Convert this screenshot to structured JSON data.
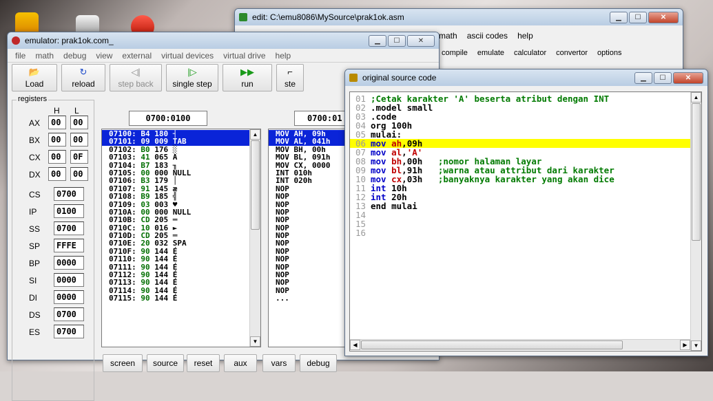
{
  "edit_window": {
    "title": "edit: C:\\emu8086\\MySource\\prak1ok.asm",
    "menu": [
      "math",
      "ascii codes",
      "help"
    ],
    "tools": [
      "compile",
      "emulate",
      "calculator",
      "convertor",
      "options"
    ]
  },
  "emulator": {
    "title": "emulator: prak1ok.com_",
    "menu": [
      "file",
      "math",
      "debug",
      "view",
      "external",
      "virtual devices",
      "virtual drive",
      "help"
    ],
    "toolbar": {
      "load": "Load",
      "reload": "reload",
      "step_back": "step back",
      "single_step": "single step",
      "run": "run",
      "step_delay": "ste"
    },
    "registers": {
      "legend": "registers",
      "h": "H",
      "l": "L",
      "ax": {
        "name": "AX",
        "h": "00",
        "l": "00"
      },
      "bx": {
        "name": "BX",
        "h": "00",
        "l": "00"
      },
      "cx": {
        "name": "CX",
        "h": "00",
        "l": "0F"
      },
      "dx": {
        "name": "DX",
        "h": "00",
        "l": "00"
      },
      "cs": {
        "name": "CS",
        "v": "0700"
      },
      "ip": {
        "name": "IP",
        "v": "0100"
      },
      "ss": {
        "name": "SS",
        "v": "0700"
      },
      "sp": {
        "name": "SP",
        "v": "FFFE"
      },
      "bp": {
        "name": "BP",
        "v": "0000"
      },
      "si": {
        "name": "SI",
        "v": "0000"
      },
      "di": {
        "name": "DI",
        "v": "0000"
      },
      "ds": {
        "name": "DS",
        "v": "0700"
      },
      "es": {
        "name": "ES",
        "v": "0700"
      }
    },
    "mem_address": "0700:0100",
    "dis_address": "0700:01",
    "memory": [
      {
        "a": "07100:",
        "h": "B4",
        "d": "180",
        "c": "┤"
      },
      {
        "a": "07101:",
        "h": "09",
        "d": "009",
        "c": "TAB"
      },
      {
        "a": "07102:",
        "h": "B0",
        "d": "176",
        "c": "░"
      },
      {
        "a": "07103:",
        "h": "41",
        "d": "065",
        "c": "A"
      },
      {
        "a": "07104:",
        "h": "B7",
        "d": "183",
        "c": "╖"
      },
      {
        "a": "07105:",
        "h": "00",
        "d": "000",
        "c": "NULL"
      },
      {
        "a": "07106:",
        "h": "B3",
        "d": "179",
        "c": "│"
      },
      {
        "a": "07107:",
        "h": "91",
        "d": "145",
        "c": "æ"
      },
      {
        "a": "07108:",
        "h": "B9",
        "d": "185",
        "c": "╣"
      },
      {
        "a": "07109:",
        "h": "03",
        "d": "003",
        "c": "♥"
      },
      {
        "a": "0710A:",
        "h": "00",
        "d": "000",
        "c": "NULL"
      },
      {
        "a": "0710B:",
        "h": "CD",
        "d": "205",
        "c": "═"
      },
      {
        "a": "0710C:",
        "h": "10",
        "d": "016",
        "c": "►"
      },
      {
        "a": "0710D:",
        "h": "CD",
        "d": "205",
        "c": "═"
      },
      {
        "a": "0710E:",
        "h": "20",
        "d": "032",
        "c": "SPA"
      },
      {
        "a": "0710F:",
        "h": "90",
        "d": "144",
        "c": "É"
      },
      {
        "a": "07110:",
        "h": "90",
        "d": "144",
        "c": "É"
      },
      {
        "a": "07111:",
        "h": "90",
        "d": "144",
        "c": "É"
      },
      {
        "a": "07112:",
        "h": "90",
        "d": "144",
        "c": "É"
      },
      {
        "a": "07113:",
        "h": "90",
        "d": "144",
        "c": "É"
      },
      {
        "a": "07114:",
        "h": "90",
        "d": "144",
        "c": "É"
      },
      {
        "a": "07115:",
        "h": "90",
        "d": "144",
        "c": "É"
      }
    ],
    "disasm": [
      "MOV AH, 09h",
      "MOV AL, 041h",
      "MOV BH, 00h",
      "MOV BL, 091h",
      "MOV CX, 0000",
      "INT 010h",
      "INT 020h",
      "NOP",
      "NOP",
      "NOP",
      "NOP",
      "NOP",
      "NOP",
      "NOP",
      "NOP",
      "NOP",
      "NOP",
      "NOP",
      "NOP",
      "NOP",
      "NOP",
      "..."
    ],
    "buttons": {
      "screen": "screen",
      "source": "source",
      "reset": "reset",
      "aux": "aux",
      "vars": "vars",
      "debug": "debug"
    }
  },
  "source": {
    "title": "original source code",
    "lines": [
      {
        "n": "01",
        "t": ";Cetak karakter 'A' beserta atribut dengan INT"
      },
      {
        "n": "02",
        "t": ".model small"
      },
      {
        "n": "03",
        "t": ".code"
      },
      {
        "n": "04",
        "t": "org 100h"
      },
      {
        "n": "05",
        "t": "mulai:"
      },
      {
        "n": "06",
        "t": "mov ah,09h"
      },
      {
        "n": "07",
        "t": "mov al,'A'"
      },
      {
        "n": "08",
        "t": "mov bh,00h   ;nomor halaman layar"
      },
      {
        "n": "09",
        "t": "mov bl,91h   ;warna atau attribut dari karakter"
      },
      {
        "n": "10",
        "t": "mov cx,03h   ;banyaknya karakter yang akan dice"
      },
      {
        "n": "11",
        "t": "int 10h"
      },
      {
        "n": "12",
        "t": "int 20h"
      },
      {
        "n": "13",
        "t": "end mulai"
      },
      {
        "n": "14",
        "t": ""
      },
      {
        "n": "15",
        "t": ""
      },
      {
        "n": "16",
        "t": ""
      }
    ]
  },
  "colors": {
    "selection": "#0a24d8",
    "highlight": "#ffff00",
    "hex_green": "#006e00"
  }
}
